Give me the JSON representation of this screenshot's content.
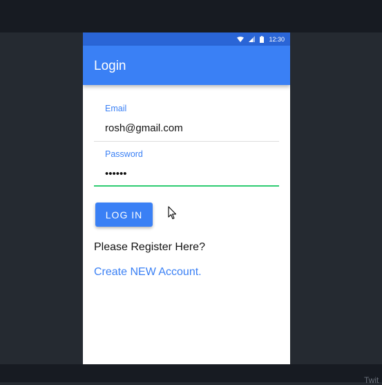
{
  "status_bar": {
    "time": "12:30",
    "icons": [
      "wifi-icon",
      "signal-icon",
      "battery-icon"
    ]
  },
  "app_bar": {
    "title": "Login"
  },
  "form": {
    "email": {
      "label": "Email",
      "value": "rosh@gmail.com"
    },
    "password": {
      "label": "Password",
      "value": "••••••"
    },
    "login_button": "LOG IN"
  },
  "register": {
    "prompt": "Please Register Here?",
    "link": "Create NEW Account."
  },
  "desktop": {
    "corner_text": "Twit"
  },
  "colors": {
    "primary": "#3a80f5",
    "status_bar": "#2a65d6",
    "focus_underline": "#2ecc71",
    "background": "#252a31"
  }
}
